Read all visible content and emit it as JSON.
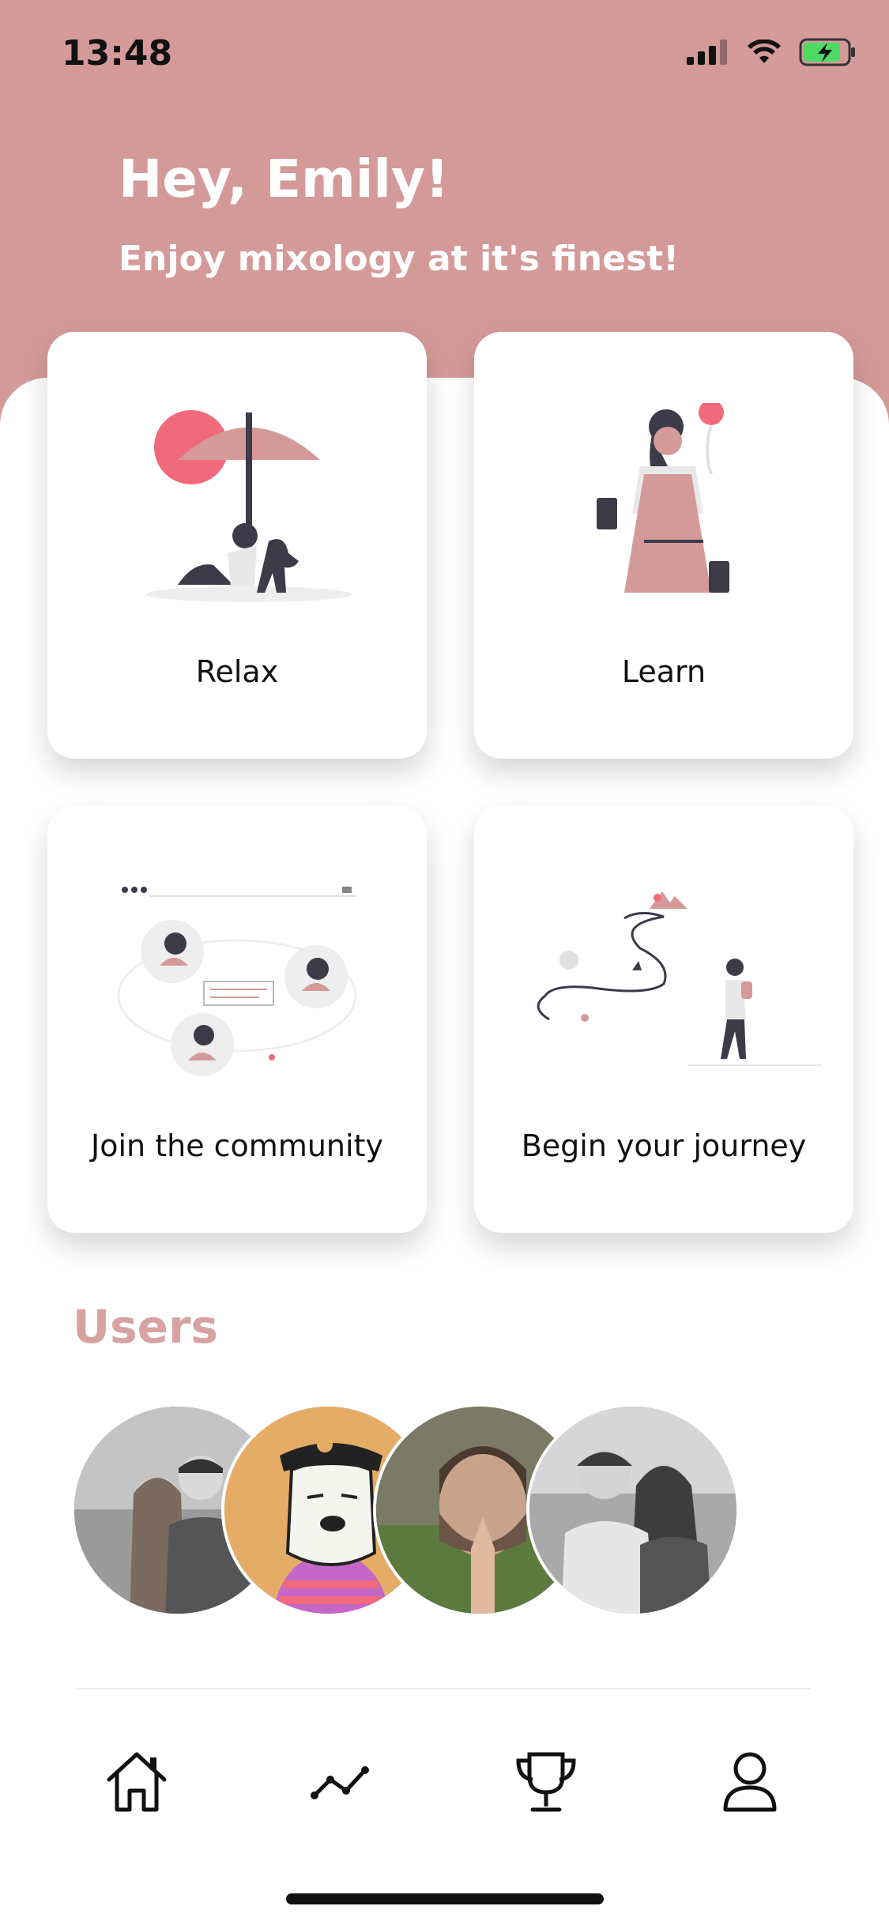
{
  "status_bar": {
    "time": "13:48"
  },
  "header": {
    "greeting": "Hey, Emily!",
    "subtitle": "Enjoy mixology at it's finest!"
  },
  "cards": [
    {
      "label": "Relax",
      "icon": "relax-illustration"
    },
    {
      "label": "Learn",
      "icon": "learn-illustration"
    },
    {
      "label": "Join the community",
      "icon": "community-illustration"
    },
    {
      "label": "Begin your journey",
      "icon": "journey-illustration"
    }
  ],
  "users": {
    "title": "Users",
    "avatars": [
      "avatar-couple",
      "avatar-cartoon-dog",
      "avatar-man-praying",
      "avatar-couple-2"
    ]
  },
  "tab_bar": {
    "items": [
      "home-icon",
      "trends-icon",
      "trophy-icon",
      "profile-icon"
    ]
  },
  "colors": {
    "accent": "#d49a99",
    "users_title": "#d6a3a1",
    "highlight": "#f06a7c"
  }
}
